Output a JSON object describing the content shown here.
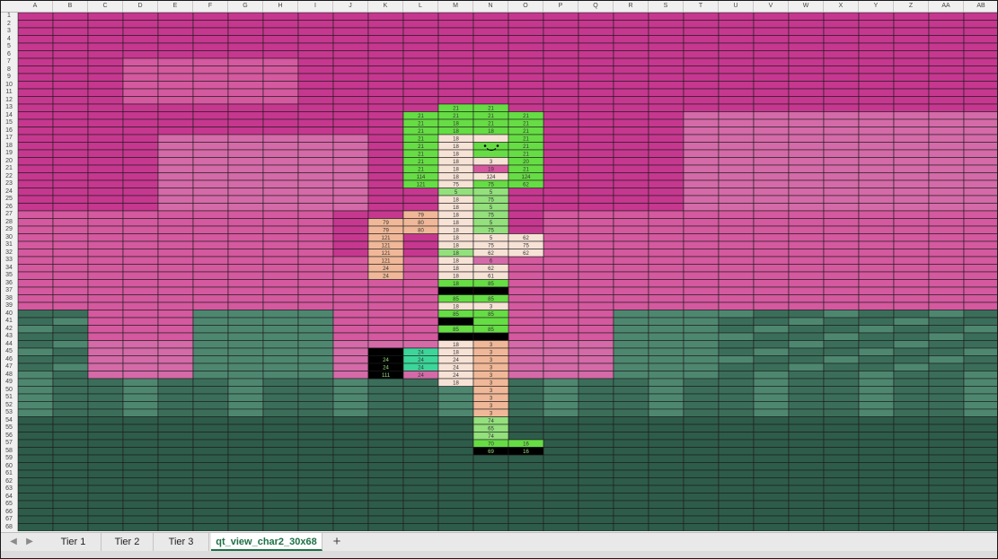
{
  "columns": [
    "A",
    "B",
    "C",
    "D",
    "E",
    "F",
    "G",
    "H",
    "I",
    "J",
    "K",
    "L",
    "M",
    "N",
    "O",
    "P",
    "Q",
    "R",
    "S",
    "T",
    "U",
    "V",
    "W",
    "X",
    "Y",
    "Z",
    "AA",
    "AB"
  ],
  "rows": [
    "1",
    "2",
    "3",
    "4",
    "5",
    "6",
    "7",
    "8",
    "9",
    "10",
    "11",
    "12",
    "13",
    "14",
    "15",
    "16",
    "17",
    "18",
    "19",
    "20",
    "21",
    "22",
    "23",
    "24",
    "25",
    "26",
    "27",
    "28",
    "29",
    "30",
    "31",
    "32",
    "33",
    "34",
    "35",
    "36",
    "37",
    "38",
    "39",
    "40",
    "41",
    "42",
    "43",
    "44",
    "45",
    "46",
    "47",
    "48",
    "49",
    "50",
    "51",
    "52",
    "53",
    "54",
    "55",
    "56",
    "57",
    "58",
    "59",
    "60",
    "61",
    "62",
    "63",
    "64",
    "65",
    "66",
    "67",
    "68"
  ],
  "colors": {
    "sky": "#c6378f",
    "sky_light": "#d4599f",
    "building": "#d46aa8",
    "ground_light": "#4e8770",
    "ground": "#3b6e5a",
    "ground_dark": "#2e5c4a",
    "char_green": "#66dd44",
    "char_green_light": "#93e07c",
    "char_skin": "#f0b898",
    "char_white": "#f7e2d6",
    "black": "#000000",
    "teal": "#3dd69a",
    "tab_accent": "#1d7044"
  },
  "cells": [
    {
      "c": 12,
      "r": 13,
      "bg": "char_green",
      "v": "21"
    },
    {
      "c": 13,
      "r": 13,
      "bg": "char_green",
      "v": "21"
    },
    {
      "c": 11,
      "r": 14,
      "bg": "char_green",
      "v": "21"
    },
    {
      "c": 12,
      "r": 14,
      "bg": "char_green",
      "v": "21"
    },
    {
      "c": 13,
      "r": 14,
      "bg": "char_green",
      "v": "21"
    },
    {
      "c": 14,
      "r": 14,
      "bg": "char_green",
      "v": "21"
    },
    {
      "c": 11,
      "r": 15,
      "bg": "char_green",
      "v": "21"
    },
    {
      "c": 12,
      "r": 15,
      "bg": "char_green",
      "v": "18"
    },
    {
      "c": 13,
      "r": 15,
      "bg": "char_green",
      "v": "21"
    },
    {
      "c": 14,
      "r": 15,
      "bg": "char_green",
      "v": "21"
    },
    {
      "c": 11,
      "r": 16,
      "bg": "char_green",
      "v": "21"
    },
    {
      "c": 12,
      "r": 16,
      "bg": "char_green",
      "v": "18"
    },
    {
      "c": 13,
      "r": 16,
      "bg": "char_green",
      "v": "18"
    },
    {
      "c": 14,
      "r": 16,
      "bg": "char_green",
      "v": "21"
    },
    {
      "c": 11,
      "r": 17,
      "bg": "char_green",
      "v": "21"
    },
    {
      "c": 12,
      "r": 17,
      "bg": "char_white",
      "v": "18"
    },
    {
      "c": 13,
      "r": 17,
      "bg": "char_white",
      "v": ""
    },
    {
      "c": 14,
      "r": 17,
      "bg": "char_green",
      "v": "21"
    },
    {
      "c": 11,
      "r": 18,
      "bg": "char_green",
      "v": "21"
    },
    {
      "c": 12,
      "r": 18,
      "bg": "char_white",
      "v": "18"
    },
    {
      "c": 13,
      "r": 18,
      "bg": "char_green",
      "v": ""
    },
    {
      "c": 14,
      "r": 18,
      "bg": "char_green",
      "v": "21"
    },
    {
      "c": 11,
      "r": 19,
      "bg": "char_green",
      "v": "21"
    },
    {
      "c": 12,
      "r": 19,
      "bg": "char_white",
      "v": "18"
    },
    {
      "c": 13,
      "r": 19,
      "bg": "char_green",
      "v": ""
    },
    {
      "c": 14,
      "r": 19,
      "bg": "char_green",
      "v": "21"
    },
    {
      "c": 11,
      "r": 20,
      "bg": "char_green",
      "v": "21"
    },
    {
      "c": 12,
      "r": 20,
      "bg": "char_white",
      "v": "18"
    },
    {
      "c": 13,
      "r": 20,
      "bg": "char_white",
      "v": "3"
    },
    {
      "c": 14,
      "r": 20,
      "bg": "char_green",
      "v": "20"
    },
    {
      "c": 11,
      "r": 21,
      "bg": "char_green",
      "v": "21"
    },
    {
      "c": 12,
      "r": 21,
      "bg": "char_white",
      "v": "18"
    },
    {
      "c": 13,
      "r": 21,
      "bg": "sky_light",
      "v": "19"
    },
    {
      "c": 14,
      "r": 21,
      "bg": "char_green",
      "v": "21"
    },
    {
      "c": 11,
      "r": 22,
      "bg": "char_green",
      "v": "114"
    },
    {
      "c": 12,
      "r": 22,
      "bg": "char_white",
      "v": "18"
    },
    {
      "c": 13,
      "r": 22,
      "bg": "char_white",
      "v": "124"
    },
    {
      "c": 14,
      "r": 22,
      "bg": "char_green",
      "v": "124"
    },
    {
      "c": 11,
      "r": 23,
      "bg": "char_green",
      "v": "121"
    },
    {
      "c": 12,
      "r": 23,
      "bg": "char_white",
      "v": "75"
    },
    {
      "c": 13,
      "r": 23,
      "bg": "char_green",
      "v": "75"
    },
    {
      "c": 14,
      "r": 23,
      "bg": "char_green",
      "v": "62"
    },
    {
      "c": 12,
      "r": 24,
      "bg": "char_green_light",
      "v": "5"
    },
    {
      "c": 13,
      "r": 24,
      "bg": "char_green_light",
      "v": "5"
    },
    {
      "c": 12,
      "r": 25,
      "bg": "char_white",
      "v": "18"
    },
    {
      "c": 13,
      "r": 25,
      "bg": "char_green_light",
      "v": "75"
    },
    {
      "c": 12,
      "r": 26,
      "bg": "char_white",
      "v": "18"
    },
    {
      "c": 13,
      "r": 26,
      "bg": "char_green_light",
      "v": "5"
    },
    {
      "c": 11,
      "r": 27,
      "bg": "char_skin",
      "v": "79"
    },
    {
      "c": 12,
      "r": 27,
      "bg": "char_white",
      "v": "18"
    },
    {
      "c": 13,
      "r": 27,
      "bg": "char_green_light",
      "v": "75"
    },
    {
      "c": 10,
      "r": 28,
      "bg": "char_skin",
      "v": "79"
    },
    {
      "c": 11,
      "r": 28,
      "bg": "char_skin",
      "v": "80"
    },
    {
      "c": 12,
      "r": 28,
      "bg": "char_white",
      "v": "18"
    },
    {
      "c": 13,
      "r": 28,
      "bg": "char_green_light",
      "v": "5"
    },
    {
      "c": 10,
      "r": 29,
      "bg": "char_skin",
      "v": "79"
    },
    {
      "c": 11,
      "r": 29,
      "bg": "char_skin",
      "v": "80"
    },
    {
      "c": 12,
      "r": 29,
      "bg": "char_white",
      "v": "18"
    },
    {
      "c": 13,
      "r": 29,
      "bg": "char_green_light",
      "v": "75"
    },
    {
      "c": 10,
      "r": 30,
      "bg": "char_skin",
      "v": "121"
    },
    {
      "c": 12,
      "r": 30,
      "bg": "char_white",
      "v": "18"
    },
    {
      "c": 13,
      "r": 30,
      "bg": "char_white",
      "v": "5"
    },
    {
      "c": 14,
      "r": 30,
      "bg": "char_white",
      "v": "62"
    },
    {
      "c": 10,
      "r": 31,
      "bg": "char_skin",
      "v": "121"
    },
    {
      "c": 12,
      "r": 31,
      "bg": "char_white",
      "v": "18"
    },
    {
      "c": 13,
      "r": 31,
      "bg": "char_white",
      "v": "75"
    },
    {
      "c": 14,
      "r": 31,
      "bg": "char_white",
      "v": "75"
    },
    {
      "c": 10,
      "r": 32,
      "bg": "char_skin",
      "v": "121"
    },
    {
      "c": 12,
      "r": 32,
      "bg": "char_green_light",
      "v": "18"
    },
    {
      "c": 13,
      "r": 32,
      "bg": "char_white",
      "v": "62"
    },
    {
      "c": 14,
      "r": 32,
      "bg": "char_white",
      "v": "62"
    },
    {
      "c": 10,
      "r": 33,
      "bg": "char_skin",
      "v": "121"
    },
    {
      "c": 12,
      "r": 33,
      "bg": "char_white",
      "v": "18"
    },
    {
      "c": 13,
      "r": 33,
      "bg": "building",
      "v": "6"
    },
    {
      "c": 10,
      "r": 34,
      "bg": "char_skin",
      "v": "24"
    },
    {
      "c": 12,
      "r": 34,
      "bg": "char_white",
      "v": "18"
    },
    {
      "c": 13,
      "r": 34,
      "bg": "char_white",
      "v": "62"
    },
    {
      "c": 10,
      "r": 35,
      "bg": "char_skin",
      "v": "24"
    },
    {
      "c": 12,
      "r": 35,
      "bg": "char_white",
      "v": "18"
    },
    {
      "c": 13,
      "r": 35,
      "bg": "char_white",
      "v": "61"
    },
    {
      "c": 12,
      "r": 36,
      "bg": "char_green",
      "v": "18"
    },
    {
      "c": 13,
      "r": 36,
      "bg": "char_green",
      "v": "85"
    },
    {
      "c": 12,
      "r": 37,
      "bg": "black",
      "v": ""
    },
    {
      "c": 13,
      "r": 37,
      "bg": "black",
      "v": ""
    },
    {
      "c": 12,
      "r": 38,
      "bg": "char_green",
      "v": "85"
    },
    {
      "c": 13,
      "r": 38,
      "bg": "char_green",
      "v": "85"
    },
    {
      "c": 12,
      "r": 39,
      "bg": "char_white",
      "v": "18"
    },
    {
      "c": 13,
      "r": 39,
      "bg": "char_white",
      "v": "3"
    },
    {
      "c": 12,
      "r": 40,
      "bg": "char_green",
      "v": "85"
    },
    {
      "c": 13,
      "r": 40,
      "bg": "char_green",
      "v": "85"
    },
    {
      "c": 12,
      "r": 41,
      "bg": "black",
      "v": ""
    },
    {
      "c": 13,
      "r": 41,
      "bg": "char_green",
      "v": ""
    },
    {
      "c": 12,
      "r": 42,
      "bg": "char_green",
      "v": "85"
    },
    {
      "c": 13,
      "r": 42,
      "bg": "char_green",
      "v": "85"
    },
    {
      "c": 12,
      "r": 43,
      "bg": "black",
      "v": ""
    },
    {
      "c": 13,
      "r": 43,
      "bg": "black",
      "v": ""
    },
    {
      "c": 12,
      "r": 44,
      "bg": "char_white",
      "v": "18"
    },
    {
      "c": 13,
      "r": 44,
      "bg": "char_skin",
      "v": "3"
    },
    {
      "c": 10,
      "r": 45,
      "bg": "black",
      "v": ""
    },
    {
      "c": 11,
      "r": 45,
      "bg": "teal",
      "v": "24"
    },
    {
      "c": 12,
      "r": 45,
      "bg": "char_white",
      "v": "18"
    },
    {
      "c": 13,
      "r": 45,
      "bg": "char_skin",
      "v": "3"
    },
    {
      "c": 10,
      "r": 46,
      "bg": "black",
      "v": "24"
    },
    {
      "c": 11,
      "r": 46,
      "bg": "teal",
      "v": "24"
    },
    {
      "c": 12,
      "r": 46,
      "bg": "char_white",
      "v": "24"
    },
    {
      "c": 13,
      "r": 46,
      "bg": "char_skin",
      "v": "3"
    },
    {
      "c": 10,
      "r": 47,
      "bg": "black",
      "v": "24"
    },
    {
      "c": 11,
      "r": 47,
      "bg": "teal",
      "v": "24"
    },
    {
      "c": 12,
      "r": 47,
      "bg": "char_white",
      "v": "24"
    },
    {
      "c": 13,
      "r": 47,
      "bg": "char_skin",
      "v": "3"
    },
    {
      "c": 10,
      "r": 48,
      "bg": "black",
      "v": "111"
    },
    {
      "c": 11,
      "r": 48,
      "bg": "building",
      "v": "24"
    },
    {
      "c": 12,
      "r": 48,
      "bg": "char_white",
      "v": "24"
    },
    {
      "c": 13,
      "r": 48,
      "bg": "char_skin",
      "v": "3"
    },
    {
      "c": 12,
      "r": 49,
      "bg": "char_white",
      "v": "18"
    },
    {
      "c": 13,
      "r": 49,
      "bg": "char_skin",
      "v": "3"
    },
    {
      "c": 13,
      "r": 50,
      "bg": "char_skin",
      "v": "3"
    },
    {
      "c": 13,
      "r": 51,
      "bg": "char_skin",
      "v": "3"
    },
    {
      "c": 13,
      "r": 52,
      "bg": "char_skin",
      "v": "3"
    },
    {
      "c": 13,
      "r": 53,
      "bg": "char_skin",
      "v": "3"
    },
    {
      "c": 13,
      "r": 54,
      "bg": "char_green_light",
      "v": "74"
    },
    {
      "c": 13,
      "r": 55,
      "bg": "char_green_light",
      "v": "65"
    },
    {
      "c": 13,
      "r": 56,
      "bg": "char_green_light",
      "v": "74"
    },
    {
      "c": 13,
      "r": 57,
      "bg": "char_green",
      "v": "70"
    },
    {
      "c": 14,
      "r": 57,
      "bg": "char_green",
      "v": "16"
    },
    {
      "c": 13,
      "r": 58,
      "bg": "black",
      "v": "69"
    },
    {
      "c": 14,
      "r": 58,
      "bg": "black",
      "v": "16"
    }
  ],
  "tabs": [
    {
      "label": "Tier 1",
      "active": false
    },
    {
      "label": "Tier 2",
      "active": false
    },
    {
      "label": "Tier 3",
      "active": false
    },
    {
      "label": "qt_view_char2_30x68",
      "active": true
    }
  ],
  "tab_nav": {
    "prev_icon": "chevron-left-icon",
    "next_icon": "chevron-right-icon",
    "prev_glyph": "◀",
    "next_glyph": "▶",
    "add_glyph": "+"
  }
}
